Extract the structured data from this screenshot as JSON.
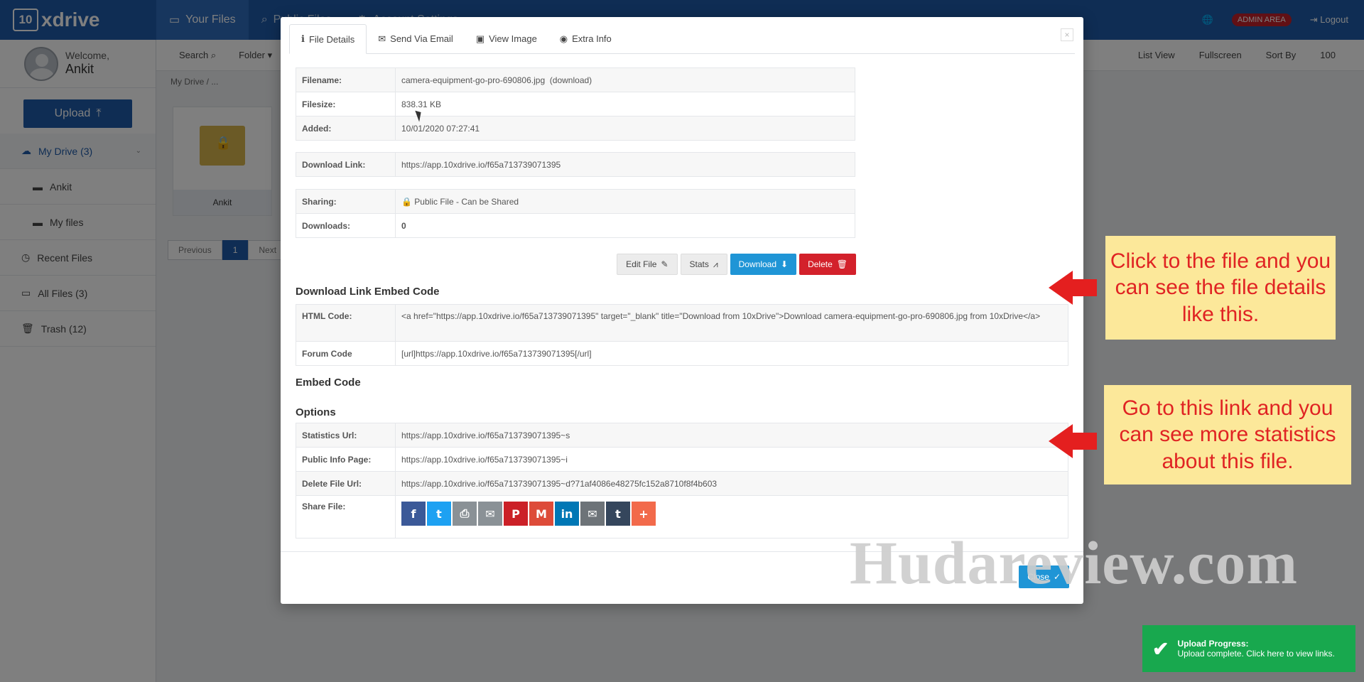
{
  "topnav": {
    "logo_mark": "10",
    "logo_text": "xdrive",
    "tabs": [
      {
        "label": "Your Files",
        "icon": "drive-icon"
      },
      {
        "label": "Public Files",
        "icon": "search-icon"
      },
      {
        "label": "Account Settings",
        "icon": "gear-icon"
      }
    ],
    "admin_label": "ADMIN AREA",
    "logout_label": "Logout"
  },
  "sidebar": {
    "welcome": "Welcome,",
    "username": "Ankit",
    "upload_label": "Upload",
    "items": [
      {
        "label": "My Drive (3)",
        "icon": "cloud-upload-icon"
      },
      {
        "label": "Ankit",
        "icon": "folder-icon"
      },
      {
        "label": "My files",
        "icon": "folder-icon"
      },
      {
        "label": "Recent Files",
        "icon": "clock-icon"
      },
      {
        "label": "All Files (3)",
        "icon": "drive-icon"
      },
      {
        "label": "Trash (12)",
        "icon": "trash-icon"
      }
    ]
  },
  "toolbar": {
    "search": "Search",
    "folder": "Folder",
    "list_view": "List View",
    "fullscreen": "Fullscreen",
    "sort_by": "Sort By",
    "per_page": "100"
  },
  "main": {
    "breadcrumb": "My Drive  /  ...",
    "folder_card": "Ankit",
    "pager": {
      "prev": "Previous",
      "page": "1",
      "next": "Next"
    }
  },
  "modal": {
    "tabs": [
      {
        "label": "File Details",
        "icon": "info-icon"
      },
      {
        "label": "Send Via Email",
        "icon": "envelope-icon"
      },
      {
        "label": "View Image",
        "icon": "image-icon"
      },
      {
        "label": "Extra Info",
        "icon": "camera-icon"
      }
    ],
    "details": {
      "filename_label": "Filename:",
      "filename": "camera-equipment-go-pro-690806.jpg",
      "download_link_text": "(download)",
      "filesize_label": "Filesize:",
      "filesize": "838.31 KB",
      "added_label": "Added:",
      "added": "10/01/2020 07:27:41",
      "dl_link_label": "Download Link:",
      "dl_link": "https://app.10xdrive.io/f65a713739071395",
      "sharing_label": "Sharing:",
      "sharing": "Public File - Can be Shared",
      "downloads_label": "Downloads:",
      "downloads": "0"
    },
    "actions": {
      "edit": "Edit File",
      "stats": "Stats",
      "download": "Download",
      "delete": "Delete"
    },
    "embed_section": "Download Link Embed Code",
    "html_code_label": "HTML Code:",
    "html_code": "<a href=\"https://app.10xdrive.io/f65a713739071395\" target=\"_blank\" title=\"Download from 10xDrive\">Download camera-equipment-go-pro-690806.jpg from 10xDrive</a>",
    "forum_code_label": "Forum Code",
    "forum_code": "[url]https://app.10xdrive.io/f65a713739071395[/url]",
    "embed_code_section": "Embed Code",
    "options_section": "Options",
    "stats_url_label": "Statistics Url:",
    "stats_url": "https://app.10xdrive.io/f65a713739071395~s",
    "public_info_label": "Public Info Page:",
    "public_info": "https://app.10xdrive.io/f65a713739071395~i",
    "delete_url_label": "Delete File Url:",
    "delete_url": "https://app.10xdrive.io/f65a713739071395~d?71af4086e48275fc152a8710f8f4b603",
    "share_label": "Share File:",
    "share_icons": [
      {
        "name": "facebook-icon",
        "glyph": "f",
        "color": "#3b5998"
      },
      {
        "name": "twitter-icon",
        "glyph": "t",
        "color": "#1da1f2"
      },
      {
        "name": "print-icon",
        "glyph": "⎙",
        "color": "#8a9196"
      },
      {
        "name": "email-icon",
        "glyph": "✉",
        "color": "#8a9196"
      },
      {
        "name": "pinterest-icon",
        "glyph": "P",
        "color": "#cb2027"
      },
      {
        "name": "gmail-icon",
        "glyph": "M",
        "color": "#dd4b39"
      },
      {
        "name": "linkedin-icon",
        "glyph": "in",
        "color": "#0077b5"
      },
      {
        "name": "inbox-icon",
        "glyph": "✉",
        "color": "#6d7378"
      },
      {
        "name": "tumblr-icon",
        "glyph": "t",
        "color": "#35465c"
      },
      {
        "name": "more-share-icon",
        "glyph": "+",
        "color": "#f26a4b"
      }
    ],
    "close_label": "Close"
  },
  "callouts": {
    "note1": "Click to the file and you can see the file details like this.",
    "note2": "Go to this link and you can see more statistics about this file."
  },
  "watermark": "Hudareview.com",
  "toast": {
    "title": "Upload Progress:",
    "message": "Upload complete. Click here to view links."
  },
  "colors": {
    "nav_blue": "#1f5ba8",
    "download_blue": "#1f95d6",
    "delete_red": "#d3212b",
    "toast_green": "#18a84e",
    "note_bg": "#fce89a",
    "note_text": "#e02323"
  }
}
